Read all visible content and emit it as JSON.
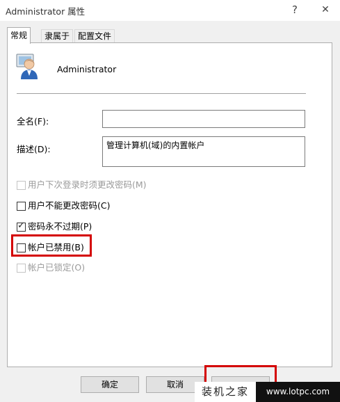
{
  "window": {
    "title": "Administrator 属性",
    "help_glyph": "?",
    "close_glyph": "✕"
  },
  "tabs": [
    {
      "label": "常规",
      "active": true
    },
    {
      "label": "隶属于",
      "active": false
    },
    {
      "label": "配置文件",
      "active": false
    }
  ],
  "general": {
    "account_name": "Administrator",
    "user_icon": "user-account-icon",
    "full_name_label": "全名(F):",
    "full_name_value": "",
    "description_label": "描述(D):",
    "description_value": "管理计算机(域)的内置帐户",
    "checkboxes": [
      {
        "label": "用户下次登录时须更改密码(M)",
        "checked": false,
        "enabled": false
      },
      {
        "label": "用户不能更改密码(C)",
        "checked": false,
        "enabled": true
      },
      {
        "label": "密码永不过期(P)",
        "checked": true,
        "enabled": true
      },
      {
        "label": "帐户已禁用(B)",
        "checked": false,
        "enabled": true
      },
      {
        "label": "帐户已锁定(O)",
        "checked": false,
        "enabled": false
      }
    ],
    "check_glyph": "✓"
  },
  "buttons": {
    "ok": "确定",
    "cancel": "取消"
  },
  "watermark": {
    "site_name": "装机之家",
    "url": "www.lotpc.com"
  },
  "colors": {
    "highlight": "#d40000",
    "dialog_bg": "#f0f0f0",
    "disabled_text": "#9a9a9a"
  }
}
